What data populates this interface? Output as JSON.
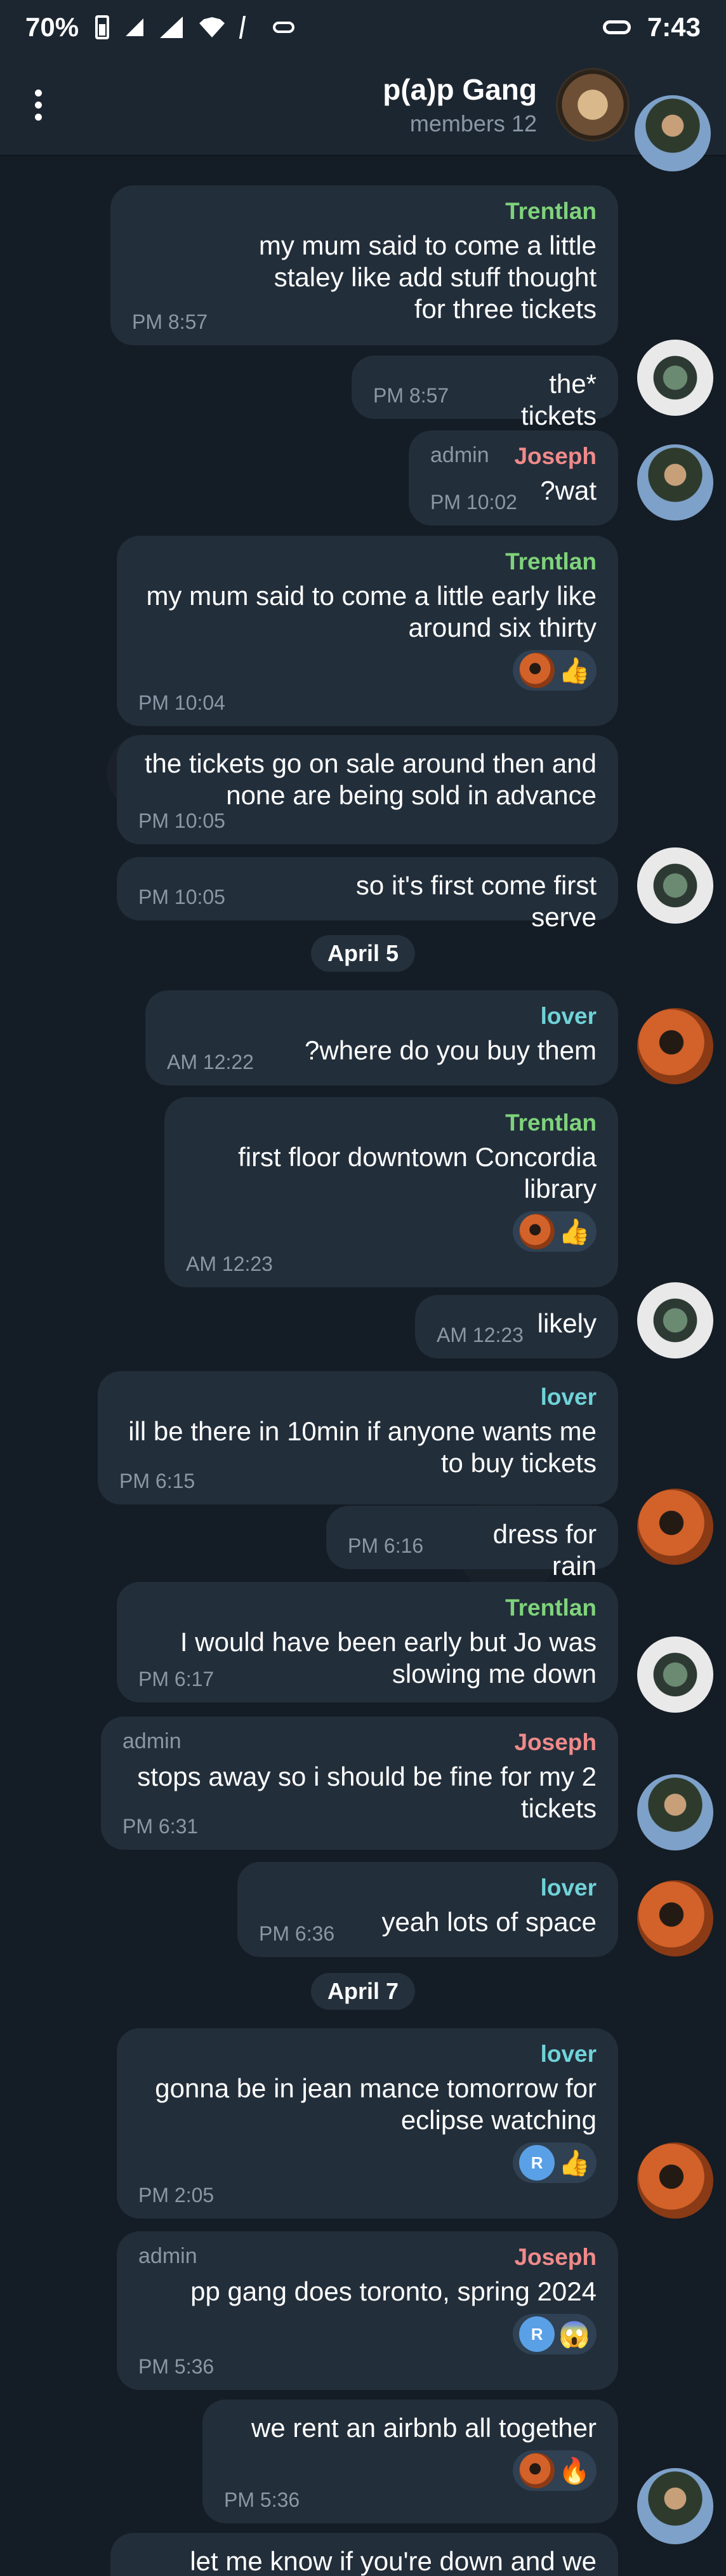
{
  "status_bar": {
    "time": "7:43",
    "battery": "70%"
  },
  "header": {
    "title": "p(a)p Gang",
    "subtitle": "12 members"
  },
  "date_labels": [
    "April 5",
    "April 7"
  ],
  "messages": [
    {
      "sender": "Trentlan",
      "text": "my mum said to come a little staley like add stuff thought for three tickets",
      "time": "8:57 PM"
    },
    {
      "sender": "",
      "text": "*the tickets",
      "time": "8:57 PM"
    },
    {
      "sender": "Joseph",
      "badge": "admin",
      "text": "wat?",
      "time": "10:02 PM"
    },
    {
      "sender": "Trentlan",
      "text": "my mum said to come a little early like around six thirty",
      "time": "10:04 PM",
      "reactions": [
        "👍"
      ]
    },
    {
      "sender": "",
      "text": "the tickets go on sale around then and none are being sold in advance",
      "time": "10:05 PM"
    },
    {
      "sender": "",
      "text": "so it's first come first serve",
      "time": "10:05 PM"
    },
    {
      "sender": "lover",
      "text": "where do you buy them?",
      "time": "12:22 AM"
    },
    {
      "sender": "Trentlan",
      "text": "first floor downtown Concordia library",
      "time": "12:23 AM",
      "reactions": [
        "👍"
      ]
    },
    {
      "sender": "",
      "text": "likely",
      "time": "12:23 AM"
    },
    {
      "sender": "lover",
      "text": "ill be there in 10min if anyone wants me to buy tickets",
      "time": "6:15 PM"
    },
    {
      "sender": "",
      "text": "dress for rain",
      "time": "6:16 PM"
    },
    {
      "sender": "Trentlan",
      "text": "I would have been early but Jo was slowing me down",
      "time": "6:17 PM"
    },
    {
      "sender": "Joseph",
      "badge": "admin",
      "text": "2 stops away so i should be fine for my tickets",
      "time": "6:31 PM"
    },
    {
      "sender": "lover",
      "text": "yeah lots of space",
      "time": "6:36 PM"
    },
    {
      "sender": "lover",
      "text": "gonna be in jean mance tomorrow for eclipse watching",
      "time": "2:05 PM",
      "reactions": [
        "👍"
      ],
      "reaction_badge": "R"
    },
    {
      "sender": "Joseph",
      "badge": "admin",
      "text": "pp gang does toronto, spring 2024",
      "time": "5:36 PM",
      "reactions": [
        "😱"
      ],
      "reaction_badge": "R"
    },
    {
      "sender": "",
      "text": "we rent an airbnb all together",
      "time": "5:36 PM",
      "reactions": [
        "🔥"
      ]
    },
    {
      "sender": "",
      "text": "let me know if you're down and we",
      "time": ""
    }
  ]
}
